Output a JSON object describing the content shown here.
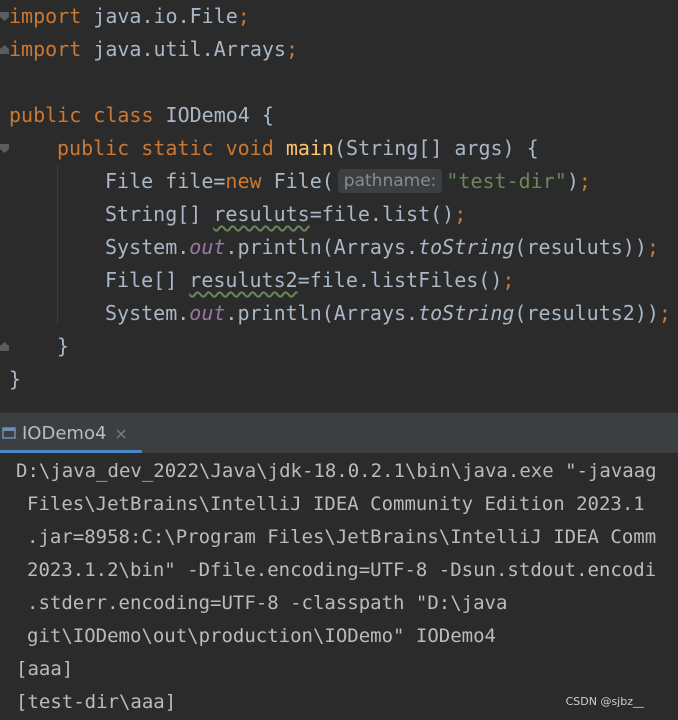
{
  "editor": {
    "line1": {
      "kw": "import",
      "rest": " java.io.File",
      "semi": ";"
    },
    "line2": {
      "kw": "import",
      "rest": " java.util.Arrays",
      "semi": ";"
    },
    "line4": {
      "kw1": "public",
      "kw2": "class",
      "name": " IODemo4 {"
    },
    "line5": {
      "kw1": "public",
      "kw2": "static",
      "kw3": "void",
      "fn": "main",
      "args": "(String[] args) {"
    },
    "line6": {
      "pre": "File file=",
      "kw": "new",
      "mid": " File(",
      "hint": "pathname:",
      "str": "\"test-dir\"",
      "post": ")",
      "semi": ";"
    },
    "line7": {
      "pre": "String[] ",
      "var": "resuluts",
      "post": "=file.list()",
      "semi": ";"
    },
    "line8": {
      "pre": "System.",
      "field": "out",
      "mid": ".println(Arrays.",
      "method": "toString",
      "post": "(resuluts))",
      "semi": ";"
    },
    "line9": {
      "pre": "File[] ",
      "var": "resuluts2",
      "post": "=file.listFiles()",
      "semi": ";"
    },
    "line10": {
      "pre": "System.",
      "field": "out",
      "mid": ".println(Arrays.",
      "method": "toString",
      "post": "(resuluts2))",
      "semi": ";"
    },
    "line11": "}",
    "line12": "}"
  },
  "run_window": {
    "tab_label": "IODemo4",
    "close_symbol": "×"
  },
  "console": {
    "lines": [
      "D:\\java_dev_2022\\Java\\jdk-18.0.2.1\\bin\\java.exe \"-javaag",
      "Files\\JetBrains\\IntelliJ IDEA Community Edition 2023.1",
      ".jar=8958:C:\\Program Files\\JetBrains\\IntelliJ IDEA Comm",
      "2023.1.2\\bin\" -Dfile.encoding=UTF-8 -Dsun.stdout.encodi",
      ".stderr.encoding=UTF-8 -classpath \"D:\\java",
      "git\\IODemo\\out\\production\\IODemo\" IODemo4",
      "[aaa]",
      "[test-dir\\aaa]"
    ]
  },
  "watermark": "CSDN @sjbz__",
  "colors": {
    "background": "#2b2b2b",
    "keyword": "#cc7832",
    "function": "#ffc66d",
    "string": "#6a8759",
    "field": "#9876aa",
    "text": "#a9b7c6",
    "tab_accent": "#4a88c7"
  }
}
